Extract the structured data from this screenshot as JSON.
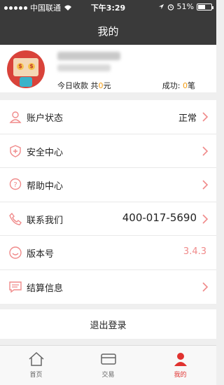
{
  "status_bar": {
    "carrier": "中国联通",
    "time": "下午3:29",
    "battery": "51%"
  },
  "nav": {
    "title": "我的"
  },
  "profile": {
    "today_label": "今日收款 共",
    "today_amount": "0",
    "today_unit": "元",
    "success_label": "成功: ",
    "success_count": "0",
    "success_unit": "笔"
  },
  "menu": [
    {
      "label": "账户状态",
      "value": "正常"
    },
    {
      "label": "安全中心",
      "value": ""
    },
    {
      "label": "帮助中心",
      "value": ""
    },
    {
      "label": "联系我们",
      "value": "400-017-5690"
    },
    {
      "label": "版本号",
      "value": "3.4.3"
    },
    {
      "label": "结算信息",
      "value": ""
    }
  ],
  "logout": {
    "label": "退出登录"
  },
  "tabs": [
    {
      "label": "首页"
    },
    {
      "label": "交易"
    },
    {
      "label": "我的"
    }
  ],
  "colors": {
    "accent": "#e0322f",
    "highlight": "#f39c12",
    "icon_pink": "#f08a8a"
  }
}
